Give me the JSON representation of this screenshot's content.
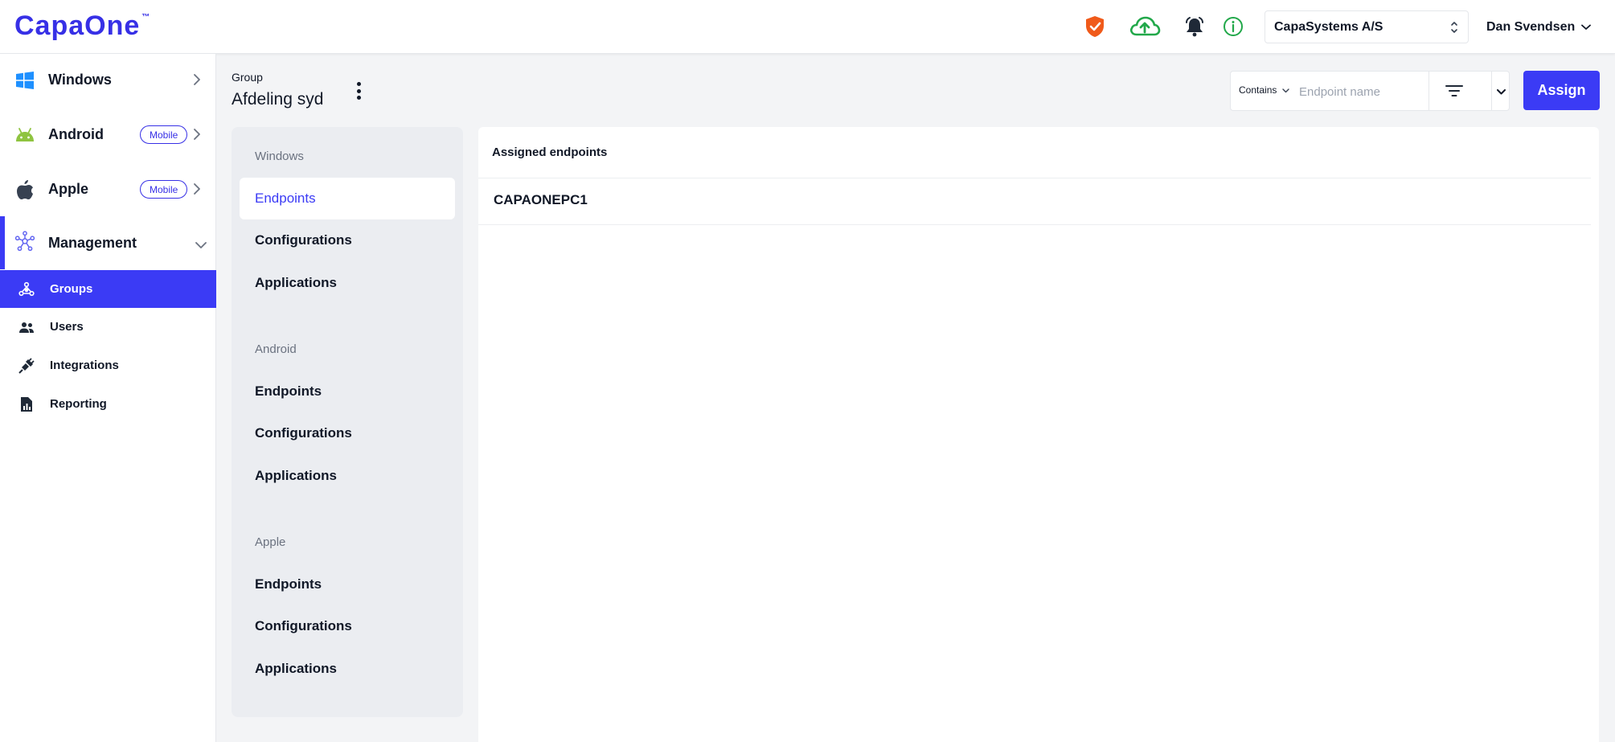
{
  "header": {
    "logo": "CapaOne",
    "logo_tm": "™",
    "icons": [
      "shield-check-icon",
      "cloud-upload-icon",
      "bell-icon",
      "info-icon"
    ],
    "org_select": "CapaSystems A/S",
    "user_name": "Dan Svendsen"
  },
  "colors": {
    "accent": "#3b3bf5",
    "shield": "#f05a1a",
    "cloud": "#22a84a",
    "info": "#22a84a",
    "windows": "#1e90ff",
    "android": "#8fc440",
    "panel_bg": "#ebedf1"
  },
  "sidebar": {
    "items": [
      {
        "label": "Windows",
        "icon": "windows-icon"
      },
      {
        "label": "Android",
        "icon": "android-icon",
        "badge": "Mobile"
      },
      {
        "label": "Apple",
        "icon": "apple-icon",
        "badge": "Mobile"
      },
      {
        "label": "Management",
        "icon": "network-icon",
        "expanded": true
      }
    ],
    "sub_items": [
      {
        "label": "Groups",
        "icon": "groups-icon",
        "active": true
      },
      {
        "label": "Users",
        "icon": "users-icon"
      },
      {
        "label": "Integrations",
        "icon": "plug-icon"
      },
      {
        "label": "Reporting",
        "icon": "report-icon"
      }
    ]
  },
  "page": {
    "breadcrumb": "Group",
    "title": "Afdeling syd"
  },
  "toolbar": {
    "contains_label": "Contains",
    "search_placeholder": "Endpoint name",
    "assign_label": "Assign"
  },
  "secondary_nav": {
    "sections": [
      {
        "heading": "Windows",
        "items": [
          "Endpoints",
          "Configurations",
          "Applications"
        ]
      },
      {
        "heading": "Android",
        "items": [
          "Endpoints",
          "Configurations",
          "Applications"
        ]
      },
      {
        "heading": "Apple",
        "items": [
          "Endpoints",
          "Configurations",
          "Applications"
        ]
      }
    ],
    "active": "Windows Endpoints"
  },
  "content": {
    "heading": "Assigned endpoints",
    "rows": [
      "CAPAONEPC1"
    ]
  }
}
